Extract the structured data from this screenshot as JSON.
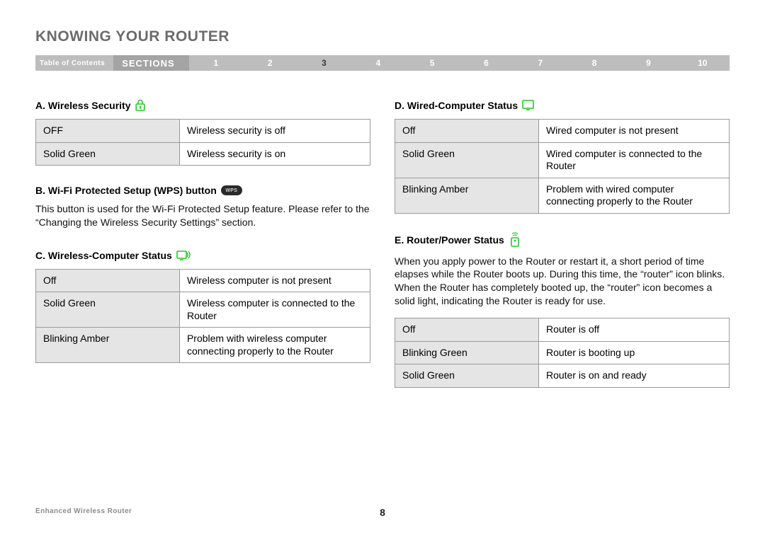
{
  "title": "KNOWING YOUR ROUTER",
  "nav": {
    "toc": "Table of Contents",
    "sections": "SECTIONS",
    "numbers": [
      "1",
      "2",
      "3",
      "4",
      "5",
      "6",
      "7",
      "8",
      "9",
      "10"
    ],
    "active": "3"
  },
  "sections": {
    "A": {
      "head": "A. Wireless Security",
      "rows": [
        [
          "OFF",
          "Wireless security is off"
        ],
        [
          "Solid Green",
          "Wireless security is on"
        ]
      ]
    },
    "B": {
      "head": "B. Wi-Fi Protected Setup (WPS) button",
      "badge": "WPS",
      "note": "This button is used for the Wi-Fi Protected Setup feature. Please refer to the “Changing the Wireless Security Settings” section."
    },
    "C": {
      "head": "C. Wireless-Computer Status",
      "rows": [
        [
          "Off",
          "Wireless computer is not present"
        ],
        [
          "Solid Green",
          "Wireless computer is connected to the Router"
        ],
        [
          "Blinking Amber",
          "Problem with wireless computer connecting properly to the Router"
        ]
      ]
    },
    "D": {
      "head": "D. Wired-Computer Status",
      "rows": [
        [
          "Off",
          "Wired computer is not present"
        ],
        [
          "Solid Green",
          "Wired computer is connected to the Router"
        ],
        [
          "Blinking Amber",
          "Problem with wired computer connecting properly to the Router"
        ]
      ]
    },
    "E": {
      "head": "E. Router/Power Status",
      "note": "When you apply power to the Router or restart it, a short period of time elapses while the Router boots up. During this time, the “router” icon blinks. When the Router has completely booted up, the “router” icon becomes a solid light, indicating the Router is ready for use.",
      "rows": [
        [
          "Off",
          "Router is off"
        ],
        [
          "Blinking Green",
          "Router is booting up"
        ],
        [
          "Solid Green",
          "Router is on and ready"
        ]
      ]
    }
  },
  "footer": {
    "product": "Enhanced Wireless Router",
    "page": "8"
  }
}
